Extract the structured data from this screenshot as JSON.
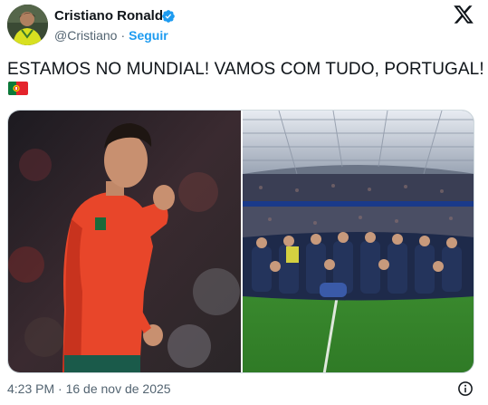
{
  "author": {
    "name": "Cristiano Ronaldo",
    "handle": "@Cristiano",
    "separator": "·",
    "follow_label": "Seguir",
    "verified_color": "#1d9bf0"
  },
  "tweet": {
    "text": "ESTAMOS NO MUNDIAL! VAMOS COM TUDO, PORTUGAL!",
    "emoji": "portugal-flag"
  },
  "media": [
    {
      "description_icon": "photo",
      "alt": "player-celebrating"
    },
    {
      "description_icon": "photo",
      "alt": "team-group-photo-stadium"
    }
  ],
  "footer": {
    "timestamp": "4:23 PM · 16 de nov de 2025"
  },
  "colors": {
    "accent": "#1d9bf0",
    "text_primary": "#0f1419",
    "text_secondary": "#536471",
    "border": "#cfd9de"
  }
}
